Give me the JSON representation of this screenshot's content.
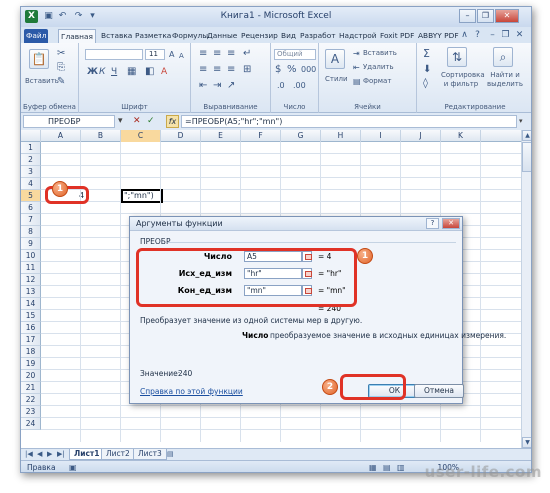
{
  "window": {
    "title": "Книга1 - Microsoft Excel",
    "app_icon": "X",
    "qa_icons": [
      "save-icon",
      "undo-icon",
      "redo-icon"
    ],
    "controls": [
      "–",
      "❐",
      "✕"
    ]
  },
  "tabs": [
    {
      "label": "Файл"
    },
    {
      "label": "Главная"
    },
    {
      "label": "Вставка"
    },
    {
      "label": "Разметка"
    },
    {
      "label": "Формулы"
    },
    {
      "label": "Данные"
    },
    {
      "label": "Рецензир"
    },
    {
      "label": "Вид"
    },
    {
      "label": "Разработ"
    },
    {
      "label": "Надстрой"
    },
    {
      "label": "Foxit PDF"
    },
    {
      "label": "ABBYY PDF"
    }
  ],
  "ribbon": {
    "groups": [
      {
        "label": "Буфер обмена"
      },
      {
        "label": "Шрифт"
      },
      {
        "label": "Выравнивание"
      },
      {
        "label": "Число"
      },
      {
        "label": "Ячейки"
      },
      {
        "label": "Редактирование"
      }
    ],
    "paste_label": "Вставить",
    "font_size": "11",
    "number_format": "Общий",
    "styles_label": "Стили",
    "cells_insert": "Вставить",
    "cells_delete": "Удалить",
    "cells_format": "Формат",
    "sort_label": "Сортировка и фильтр",
    "find_label": "Найти и выделить",
    "font_buttons": [
      "Ж",
      "К",
      "Ч"
    ],
    "sum_symbol": "Σ"
  },
  "formula_bar": {
    "name_box": "ПРЕОБР",
    "cancel": "✕",
    "enter": "✓",
    "fx": "fx",
    "formula": "=ПРЕОБР(A5;\"hr\";\"mn\")"
  },
  "grid": {
    "columns": [
      "A",
      "B",
      "C",
      "D",
      "E",
      "F",
      "G",
      "H",
      "I",
      "J",
      "K"
    ],
    "rows": [
      "1",
      "2",
      "3",
      "4",
      "5",
      "6",
      "7",
      "8",
      "9",
      "10",
      "11",
      "12",
      "13",
      "14",
      "15",
      "16",
      "17",
      "18",
      "19",
      "20",
      "21",
      "22",
      "23",
      "24"
    ],
    "a5_value": "4",
    "c5_value": "\";\"mn\")"
  },
  "sheets": {
    "tabs": [
      "Лист1",
      "Лист2",
      "Лист3"
    ],
    "active": "Лист1"
  },
  "status": {
    "mode": "Правка",
    "zoom": "100%"
  },
  "dialog": {
    "title": "Аргументы функции",
    "function_name": "ПРЕОБР",
    "arguments": [
      {
        "label": "Число",
        "value": "A5",
        "result": "4"
      },
      {
        "label": "Исх_ед_изм",
        "value": "\"hr\"",
        "result": "\"hr\""
      },
      {
        "label": "Кон_ед_изм",
        "value": "\"mn\"",
        "result": "\"mn\""
      }
    ],
    "total_result": "240",
    "description": "Преобразует значение из одной системы мер в другую.",
    "arg_help_name": "Число",
    "arg_help_text": "преобразуемое значение в исходных единицах измерения.",
    "value_label": "Значение:",
    "value": "240",
    "help_link": "Справка по этой функции",
    "ok_label": "ОК",
    "cancel_label": "Отмена",
    "help_button": "?",
    "close_button": "✕"
  },
  "annotations": {
    "badge_a5": "1",
    "badge_args": "1",
    "badge_ok": "2"
  },
  "watermark": "user-life.com"
}
